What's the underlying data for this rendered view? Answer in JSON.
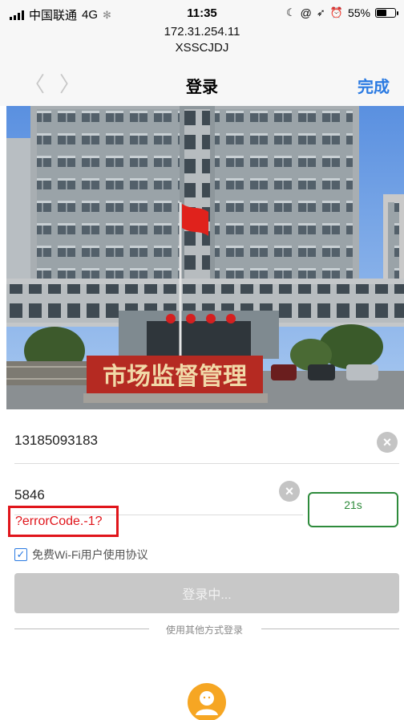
{
  "status_bar": {
    "carrier": "中国联通",
    "network": "4G",
    "time": "11:35",
    "battery_percent": "55%",
    "battery_level": 0.55,
    "icons": [
      "signal-icon",
      "loading-icon",
      "alarm-icon",
      "at-icon",
      "location-arrow-icon",
      "clock-icon",
      "battery-icon"
    ]
  },
  "url": {
    "host": "172.31.254.11",
    "path": "XSSCJDJ"
  },
  "nav": {
    "back_icon": "chevron-left-icon",
    "forward_icon": "chevron-right-icon",
    "title": "登录",
    "done_label": "完成"
  },
  "hero": {
    "sign_text": "市场监督管理"
  },
  "form": {
    "phone_value": "13185093183",
    "code_value": "5846",
    "countdown_label": "21s",
    "error_text": "?errorCode.-1?",
    "agreement_label": "免费Wi-Fi用户使用协议",
    "agreement_checked": true,
    "login_label": "登录中..."
  },
  "other_login": {
    "divider_label": "使用其他方式登录",
    "avatar_icon": "user-avatar-icon"
  },
  "colors": {
    "accent_blue": "#2a7ae2",
    "error_red": "#e0151b",
    "countdown_green": "#2e8b3c",
    "avatar_orange": "#f6a623"
  }
}
